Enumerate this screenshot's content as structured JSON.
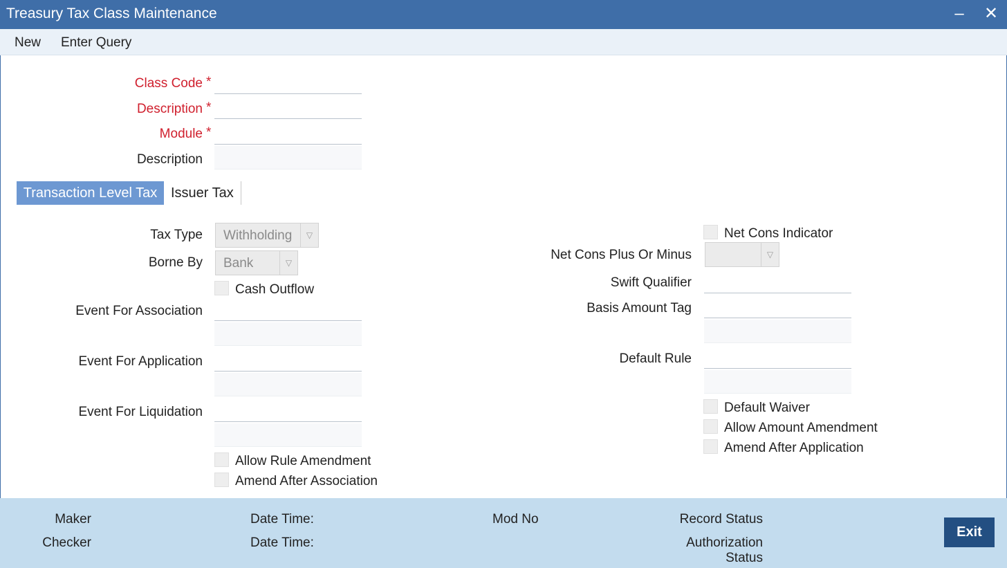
{
  "window": {
    "title": "Treasury Tax Class Maintenance",
    "minimize_glyph": "–",
    "close_glyph": "✕"
  },
  "menu": {
    "new": "New",
    "enter_query": "Enter Query"
  },
  "header": {
    "class_code_label": "Class Code",
    "description_label": "Description",
    "module_label": "Module",
    "module_description_label": "Description",
    "required_mark": "*",
    "class_code_value": "",
    "description_value": "",
    "module_value": "",
    "module_description_value": ""
  },
  "tabs": {
    "active": "Transaction Level Tax",
    "other": "Issuer Tax"
  },
  "left": {
    "tax_type_label": "Tax Type",
    "tax_type_value": "Withholding",
    "borne_by_label": "Borne By",
    "borne_by_value": "Bank",
    "cash_outflow": "Cash Outflow",
    "event_association_label": "Event For Association",
    "event_application_label": "Event For Application",
    "event_liquidation_label": "Event For Liquidation",
    "allow_rule_amendment": "Allow Rule Amendment",
    "amend_after_association": "Amend After Association"
  },
  "right": {
    "net_cons_indicator": "Net Cons Indicator",
    "net_cons_plus_minus_label": "Net Cons Plus Or Minus",
    "net_cons_plus_minus_value": "",
    "swift_qualifier_label": "Swift Qualifier",
    "basis_amount_tag_label": "Basis Amount Tag",
    "default_rule_label": "Default Rule",
    "default_waiver": "Default Waiver",
    "allow_amount_amendment": "Allow Amount Amendment",
    "amend_after_application": "Amend After Application"
  },
  "footer": {
    "maker": "Maker",
    "checker": "Checker",
    "date_time_1": "Date Time:",
    "date_time_2": "Date Time:",
    "mod_no": "Mod No",
    "record_status": "Record Status",
    "authorization": "Authorization",
    "status": "Status",
    "exit": "Exit"
  },
  "colors": {
    "titlebar": "#3f6ea8",
    "active_tab": "#6d98d2",
    "required": "#d0202e",
    "footer": "#c3dcee",
    "exit_button": "#234f82"
  }
}
